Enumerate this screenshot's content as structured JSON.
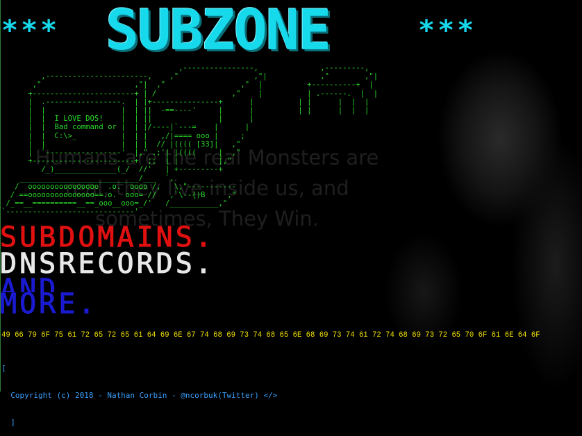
{
  "banner": {
    "left_stars": "*** ",
    "title": "SUBZONE",
    "right_stars": " ***"
  },
  "ascii_art": "                                        ,----------------,              ,---------,\n         ,-----------------------,    ,\"                 ,\"|            ,\"        ,\"|\n       ,\"                     ,\"|  ,\"                 ,\"  |          +----------+  |\n      +-----------------------+ | /                 ,\"    |          | .------.  |  |\n      |  .-----------------.  | |+---------------+      |          | |      |  |  |\n      |  |                 |  | ||  -==----'     |      |          | |      |  |  |\n      |  |  I LOVE DOS!    |  | ||               |      |\n      |  |  Bad command or |  | |/----|`---=    |      |\n      |  |  C:\\>_          |  | |   ,/|==== ooo |     ;\n      |  |                 |  | |  // |(((( [33]|   ,\"\n      |  `-----------------'  |,\" .;'| |((((     |  ,\"\n      +-----------------------+  ;;  | |         |,\"\n         /_)______________(_/  //'   | +---------+\n    ___________________________/___  `,\n   /  oooooooooooooooo  .o.  oooo /,   \\,\"-----------\n  / ==ooooooooooooooo==.o.  ooo= //   ,`\\--{)B     ,\"\n /_==__==========__==_ooo__ooo=_/'   /___________,\"\n`-----------------------------'",
  "quote": "Humans are the real Monsters are real, they live inside us, and sometimes, They Win.",
  "ascii_lines": [
    "SUBDOMAINS.",
    "DNSRECORDS.",
    "AND",
    "MORE."
  ],
  "hex_line": "49 66 79 6F 75 61 72 65 72 65 61 64 69 6E 67 74 68 69 73 74 68 65 6E 68 69 73 74 61 72 74 68 69 73 72 65 70 6F 61 6E 64 6F",
  "footer": {
    "open": "[",
    "copyright": "  Copyright (c) 2018 - Nathan Corbin - @ncorbuk(Twitter) </>",
    "close": "  ]"
  },
  "colors": {
    "background": "#000000",
    "banner": "#16d9ec",
    "ascii_art": "#29d829",
    "subdomains": "#e01010",
    "dnsrecords": "#e8e8e8",
    "and_more": "#1a1ad0",
    "hex": "#f2e200",
    "footer": "#3aa0ff"
  }
}
